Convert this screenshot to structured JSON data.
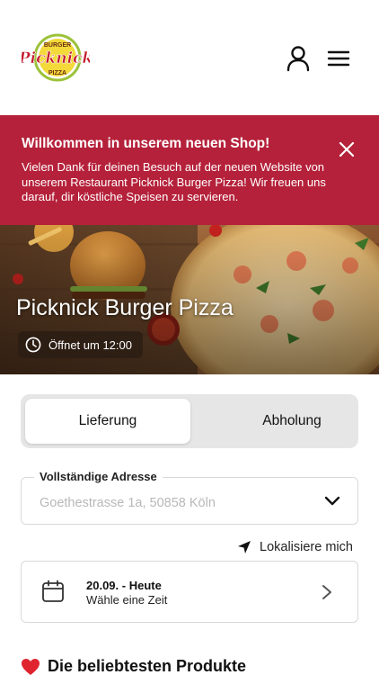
{
  "header": {
    "logo": {
      "top_text": "BURGER",
      "main_text": "Picknick",
      "bottom_text": "PIZZA"
    },
    "user_icon": "user-icon",
    "menu_icon": "hamburger-menu-icon"
  },
  "banner": {
    "title": "Willkommen in unserem neuen Shop!",
    "text": "Vielen Dank für deinen Besuch auf der neuen Website von unserem Restaurant Picknick Burger Pizza! Wir freuen uns darauf, dir köstliche Speisen zu servieren.",
    "close_icon": "close-icon",
    "color": "#b5213a"
  },
  "hero": {
    "restaurant_name": "Picknick Burger Pizza",
    "opening_status": "Öffnet um 12:00",
    "clock_icon": "clock-icon"
  },
  "order_mode": {
    "options": [
      "Lieferung",
      "Abholung"
    ],
    "selected": "Lieferung"
  },
  "address": {
    "label": "Vollständige Adresse",
    "placeholder": "Goethestrasse 1a, 50858 Köln",
    "chevron_icon": "chevron-down-icon"
  },
  "locate": {
    "label": "Lokalisiere mich",
    "icon": "location-arrow-icon"
  },
  "time": {
    "date_label": "20.09. - Heute",
    "hint": "Wähle eine Zeit",
    "calendar_icon": "calendar-icon",
    "chevron_icon": "chevron-right-icon"
  },
  "popular": {
    "heading": "Die beliebtesten Produkte",
    "icon": "heart-icon"
  }
}
